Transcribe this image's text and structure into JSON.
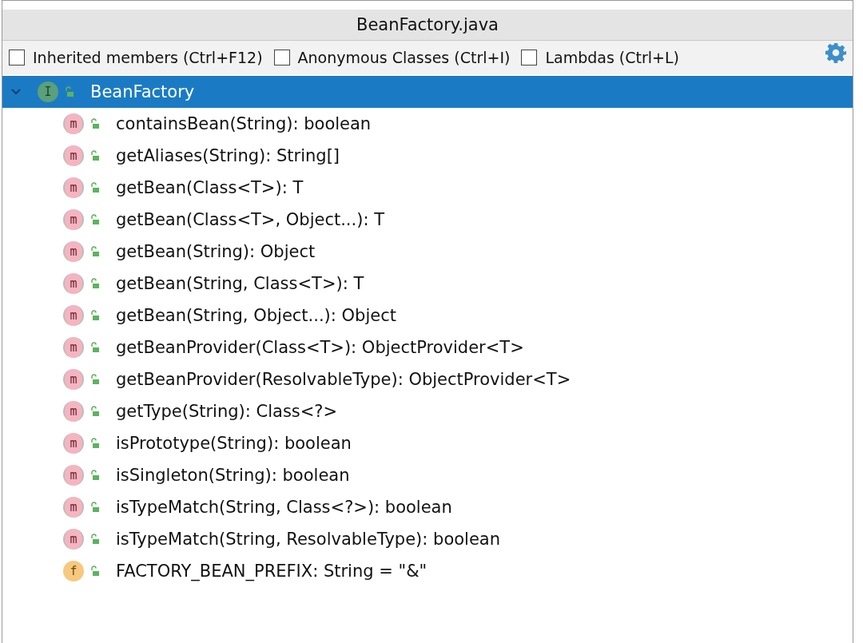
{
  "window": {
    "title": "BeanFactory.java"
  },
  "options": [
    {
      "label": "Inherited members (Ctrl+F12)",
      "checked": false
    },
    {
      "label": "Anonymous Classes (Ctrl+I)",
      "checked": false
    },
    {
      "label": "Lambdas (Ctrl+L)",
      "checked": false
    }
  ],
  "tree": {
    "label": "BeanFactory",
    "badge": "I",
    "kind": "interface",
    "expanded": true,
    "selected": true,
    "children": [
      {
        "label": "containsBean(String): boolean",
        "badge": "m",
        "kind": "method",
        "selected": false
      },
      {
        "label": "getAliases(String): String[]",
        "badge": "m",
        "kind": "method",
        "selected": false
      },
      {
        "label": "getBean(Class<T>): T",
        "badge": "m",
        "kind": "method",
        "selected": false
      },
      {
        "label": "getBean(Class<T>, Object...): T",
        "badge": "m",
        "kind": "method",
        "selected": false
      },
      {
        "label": "getBean(String): Object",
        "badge": "m",
        "kind": "method",
        "selected": false
      },
      {
        "label": "getBean(String, Class<T>): T",
        "badge": "m",
        "kind": "method",
        "selected": false
      },
      {
        "label": "getBean(String, Object...): Object",
        "badge": "m",
        "kind": "method",
        "selected": false
      },
      {
        "label": "getBeanProvider(Class<T>): ObjectProvider<T>",
        "badge": "m",
        "kind": "method",
        "selected": false
      },
      {
        "label": "getBeanProvider(ResolvableType): ObjectProvider<T>",
        "badge": "m",
        "kind": "method",
        "selected": false
      },
      {
        "label": "getType(String): Class<?>",
        "badge": "m",
        "kind": "method",
        "selected": false
      },
      {
        "label": "isPrototype(String): boolean",
        "badge": "m",
        "kind": "method",
        "selected": false
      },
      {
        "label": "isSingleton(String): boolean",
        "badge": "m",
        "kind": "method",
        "selected": false
      },
      {
        "label": "isTypeMatch(String, Class<?>): boolean",
        "badge": "m",
        "kind": "method",
        "selected": false
      },
      {
        "label": "isTypeMatch(String, ResolvableType): boolean",
        "badge": "m",
        "kind": "method",
        "selected": false
      },
      {
        "label": "FACTORY_BEAN_PREFIX: String = \"&\"",
        "badge": "f",
        "kind": "field",
        "selected": false
      }
    ]
  }
}
